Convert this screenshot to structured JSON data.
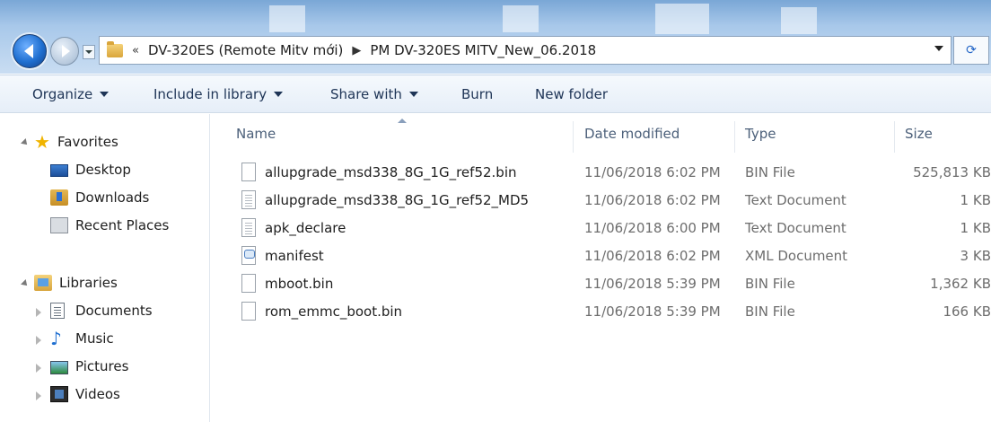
{
  "address": {
    "overflow": "«",
    "crumbs": [
      "DV-320ES (Remote Mitv mới)",
      "PM DV-320ES MITV_New_06.2018"
    ]
  },
  "toolbar": {
    "organize": "Organize",
    "include_library": "Include in library",
    "share_with": "Share with",
    "burn": "Burn",
    "new_folder": "New folder"
  },
  "nav": {
    "favorites": "Favorites",
    "desktop": "Desktop",
    "downloads": "Downloads",
    "recent": "Recent Places",
    "libraries": "Libraries",
    "documents": "Documents",
    "music": "Music",
    "pictures": "Pictures",
    "videos": "Videos"
  },
  "columns": {
    "name": "Name",
    "date": "Date modified",
    "type": "Type",
    "size": "Size"
  },
  "files": [
    {
      "name": "allupgrade_msd338_8G_1G_ref52.bin",
      "date": "11/06/2018 6:02 PM",
      "type": "BIN File",
      "size": "525,813 KB",
      "icon": "blank-file-icon"
    },
    {
      "name": "allupgrade_msd338_8G_1G_ref52_MD5",
      "date": "11/06/2018 6:02 PM",
      "type": "Text Document",
      "size": "1 KB",
      "icon": "text-file-icon"
    },
    {
      "name": "apk_declare",
      "date": "11/06/2018 6:00 PM",
      "type": "Text Document",
      "size": "1 KB",
      "icon": "text-file-icon"
    },
    {
      "name": "manifest",
      "date": "11/06/2018 6:02 PM",
      "type": "XML Document",
      "size": "3 KB",
      "icon": "xml-file-icon"
    },
    {
      "name": "mboot.bin",
      "date": "11/06/2018 5:39 PM",
      "type": "BIN File",
      "size": "1,362 KB",
      "icon": "blank-file-icon"
    },
    {
      "name": "rom_emmc_boot.bin",
      "date": "11/06/2018 5:39 PM",
      "type": "BIN File",
      "size": "166 KB",
      "icon": "blank-file-icon"
    }
  ]
}
